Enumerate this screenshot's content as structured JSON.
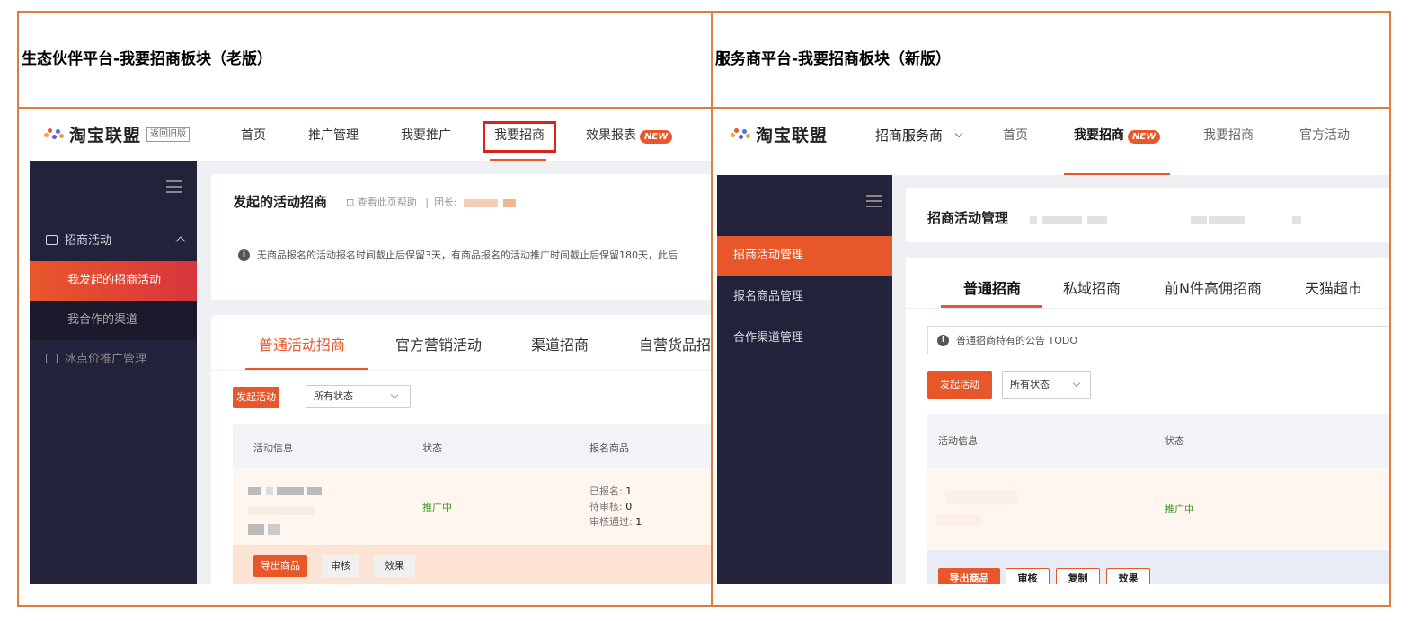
{
  "headings": {
    "left": "生态伙伴平台-我要招商板块（老版）",
    "right": "服务商平台-我要招商板块（新版）"
  },
  "brand": {
    "name": "淘宝联盟",
    "old_version_badge": "返回旧版",
    "accent": "#e8572a",
    "frame_color": "#e07c3c",
    "highlight_color": "#d9241c"
  },
  "old": {
    "nav": {
      "home": "首页",
      "promo_mgmt": "推广管理",
      "promote": "我要推广",
      "recruit": "我要招商",
      "reports": "效果报表",
      "new_badge": "NEW"
    },
    "sidebar": {
      "group": "招商活动",
      "my_activities": "我发起的招商活动",
      "my_channels": "我合作的渠道",
      "ice_price": "冰点价推广管理"
    },
    "page": {
      "title": "发起的活动招商",
      "help": "查看此页帮助",
      "leader_label": "团长:",
      "notice": "无商品报名的活动报名时间截止后保留3天，有商品报名的活动推广时间截止后保留180天，此后"
    },
    "tabs": [
      "普通活动招商",
      "官方营销活动",
      "渠道招商",
      "自营货品招"
    ],
    "toolbar": {
      "start_button": "发起活动",
      "status_select": "所有状态"
    },
    "table": {
      "headers": [
        "活动信息",
        "状态",
        "报名商品"
      ],
      "row": {
        "status": "推广中",
        "signed_label": "已报名:",
        "signed_value": "1",
        "pending_label": "待审核:",
        "pending_value": "0",
        "approved_label": "审核通过:",
        "approved_value": "1"
      }
    },
    "actions": [
      "导出商品",
      "审核",
      "效果"
    ]
  },
  "new": {
    "nav": {
      "role": "招商服务商",
      "home": "首页",
      "recruit": "我要招商",
      "new_badge": "NEW",
      "recruit2": "我要招商",
      "official": "官方活动"
    },
    "sidebar": {
      "activity_mgmt": "招商活动管理",
      "item_mgmt": "报名商品管理",
      "channel_mgmt": "合作渠道管理"
    },
    "page": {
      "title": "招商活动管理",
      "notice": "普通招商特有的公告 TODO"
    },
    "tabs": [
      "普通招商",
      "私域招商",
      "前N件高佣招商",
      "天猫超市"
    ],
    "toolbar": {
      "start_button": "发起活动",
      "status_select": "所有状态"
    },
    "table": {
      "headers": [
        "活动信息",
        "状态"
      ],
      "row": {
        "status": "推广中"
      }
    },
    "actions": [
      "导出商品",
      "审核",
      "复制",
      "效果"
    ]
  }
}
